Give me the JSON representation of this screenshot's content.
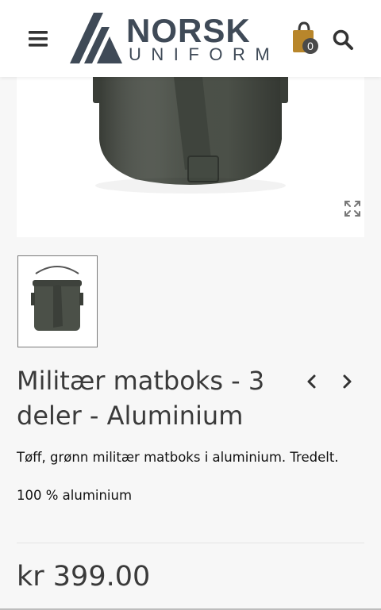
{
  "header": {
    "logo_title": "NORSK",
    "logo_subtitle": "UNIFORM",
    "cart_count": "0"
  },
  "product": {
    "title": "Militær matboks - 3 deler - Aluminium",
    "description": "Tøff, grønn militær matboks i aluminium. Tredelt.",
    "material": "100 % aluminium",
    "price": "kr 399.00"
  },
  "icons": {
    "menu": "hamburger-menu-icon",
    "cart": "shopping-bag-icon",
    "search": "search-icon",
    "zoom": "expand-icon",
    "prev": "chevron-left-icon",
    "next": "chevron-right-icon"
  },
  "colors": {
    "logo": "#3f4a57",
    "cart_bag": "#b8862b",
    "product_green": "#4b5048"
  }
}
